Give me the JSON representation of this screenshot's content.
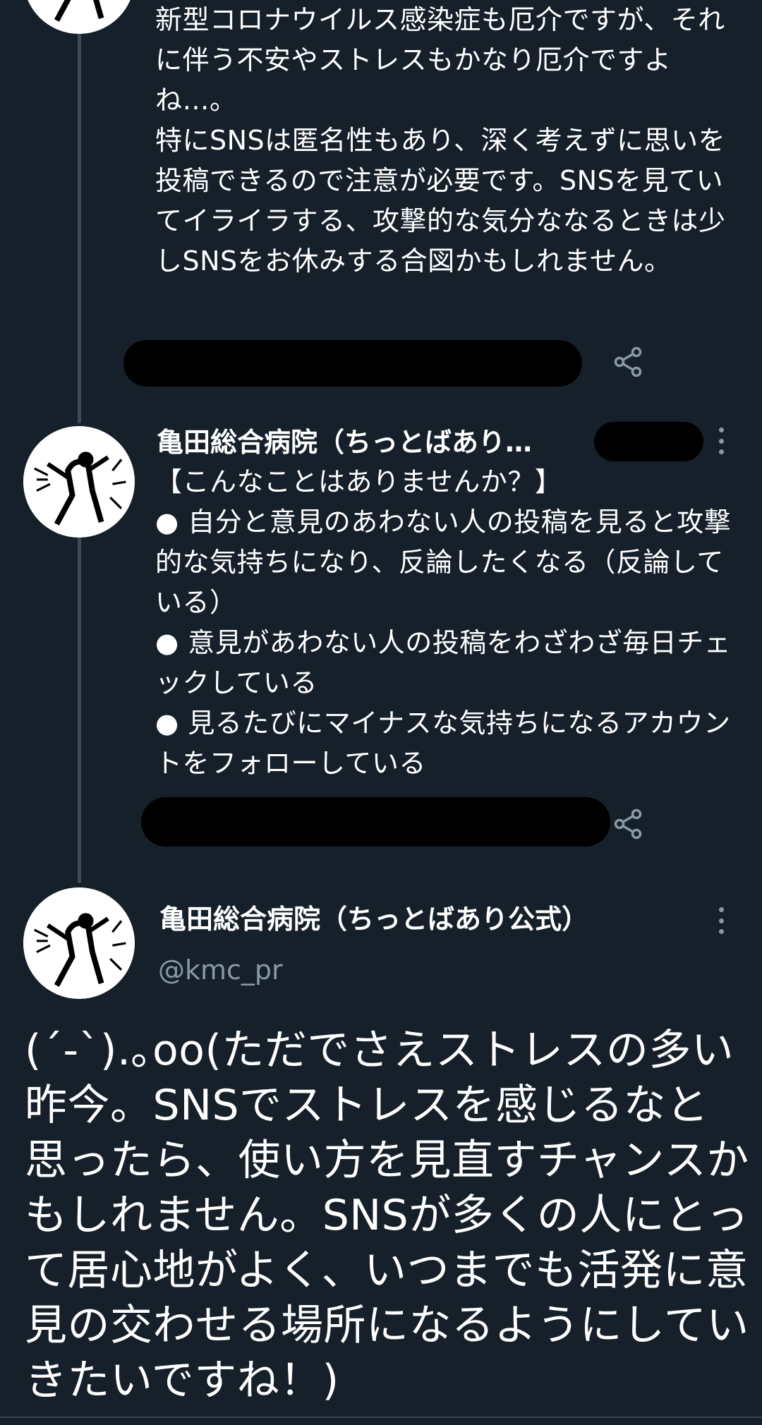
{
  "tweets": [
    {
      "text_lines": [
        "新型コロナウイルス感染症も厄介ですが、それに伴う不安やストレスもかなり厄介ですよね…。",
        "特にSNSは匿名性もあり、深く考えずに思いを投稿できるので注意が必要です。SNSを見ていてイライラする、攻撃的な気分ななるときは少しSNSをお休みする合図かもしれません。"
      ]
    },
    {
      "author_name": "亀田総合病院（ちっとばあり…",
      "text_lines": [
        "【こんなことはありませんか？】",
        "● 自分と意見のあわない人の投稿を見ると攻撃的な気持ちになり、反論したくなる（反論している）",
        "● 意見があわない人の投稿をわざわざ毎日チェックしている",
        "● 見るたびにマイナスな気持ちになるアカウントをフォローしている"
      ]
    }
  ],
  "main_tweet": {
    "author_name": "亀田総合病院（ちっとばあり公式）",
    "handle": "@kmc_pr",
    "text": "(´-`).｡oo(ただでさえストレスの多い昨今。SNSでストレスを感じるなと思ったら、使い方を見直すチャンスかもしれません。SNSが多くの人にとって居心地がよく、いつまでも活発に意見の交わせる場所になるようにしていきたいですね！)"
  },
  "icons": {
    "share": "share-icon",
    "more": "more-vertical-icon",
    "avatar": "avatar-illustration"
  },
  "colors": {
    "background": "#15202b",
    "text": "#ffffff",
    "secondary": "#8899a6",
    "thread_line": "#3d4a57"
  }
}
